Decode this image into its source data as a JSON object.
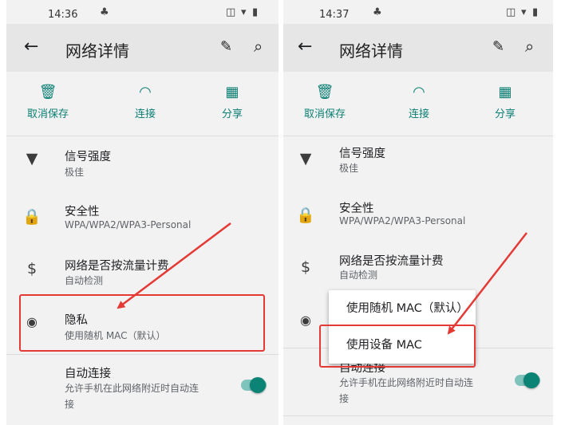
{
  "left": {
    "status": {
      "time": "14:36"
    },
    "appbar": {
      "title": "网络详情"
    },
    "actions": [
      {
        "label": "取消保存",
        "icon": "trash-icon"
      },
      {
        "label": "连接",
        "icon": "wifi-icon"
      },
      {
        "label": "分享",
        "icon": "qr-code-icon"
      }
    ],
    "rows": {
      "signal": {
        "title": "信号强度",
        "sub": "极佳"
      },
      "security": {
        "title": "安全性",
        "sub": "WPA/WPA2/WPA3-Personal"
      },
      "metered": {
        "title": "网络是否按流量计费",
        "sub": "自动检测"
      },
      "privacy": {
        "title": "隐私",
        "sub": "使用随机 MAC（默认）"
      },
      "autoconnect": {
        "title": "自动连接",
        "sub1": "允许手机在此网络附近时自动连",
        "sub2": "接"
      }
    }
  },
  "right": {
    "status": {
      "time": "14:37"
    },
    "appbar": {
      "title": "网络详情"
    },
    "actions": [
      {
        "label": "取消保存",
        "icon": "trash-icon"
      },
      {
        "label": "连接",
        "icon": "wifi-icon"
      },
      {
        "label": "分享",
        "icon": "qr-code-icon"
      }
    ],
    "rows": {
      "signal": {
        "title": "信号强度",
        "sub": "极佳"
      },
      "security": {
        "title": "安全性",
        "sub": "WPA/WPA2/WPA3-Personal"
      },
      "metered": {
        "title": "网络是否按流量计费",
        "sub": "自动检测"
      },
      "autoconnect": {
        "title": "自动连接",
        "sub1": "允许手机在此网络附近时自动连",
        "sub2": "接"
      }
    },
    "menu": [
      {
        "label": "使用随机 MAC（默认）"
      },
      {
        "label": "使用设备 MAC"
      }
    ]
  },
  "colors": {
    "accent": "#0b7f74",
    "annotation": "#e53935",
    "appbar": "#e6e6e6",
    "background": "#f2f2f2"
  }
}
